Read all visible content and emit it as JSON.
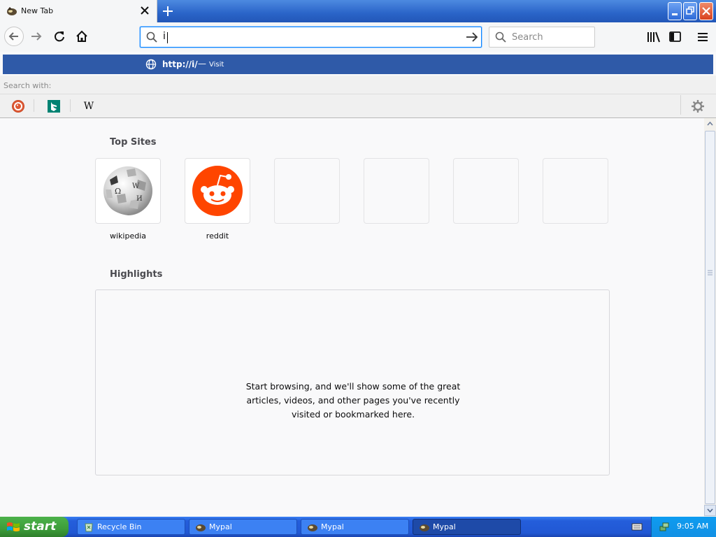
{
  "browser": {
    "tab": {
      "title": "New Tab"
    },
    "url_input": {
      "value": "i"
    },
    "search_bar": {
      "placeholder": "Search"
    },
    "suggestion": {
      "url": "http://i/",
      "dash": "—",
      "action": "Visit"
    },
    "search_with": {
      "label": "Search with:",
      "engines": [
        {
          "name": "duckduckgo-icon"
        },
        {
          "name": "bing-icon"
        },
        {
          "name": "wikipedia-icon",
          "glyph": "W"
        }
      ]
    }
  },
  "new_tab_page": {
    "top_sites_title": "Top Sites",
    "top_sites": [
      {
        "label": "wikipedia"
      },
      {
        "label": "reddit"
      }
    ],
    "highlights_title": "Highlights",
    "highlights_message": "Start browsing, and we'll show some of the great articles, videos, and other pages you've recently visited or bookmarked here."
  },
  "taskbar": {
    "start_label": "start",
    "tasks": [
      {
        "label": "Recycle Bin"
      },
      {
        "label": "Mypal"
      },
      {
        "label": "Mypal"
      },
      {
        "label": "Mypal"
      }
    ],
    "clock": "9:05 AM"
  },
  "colors": {
    "accent": "#0a84ff",
    "suggestion_bg": "#2f5aa8",
    "reddit": "#ff4500",
    "bing": "#008373"
  }
}
